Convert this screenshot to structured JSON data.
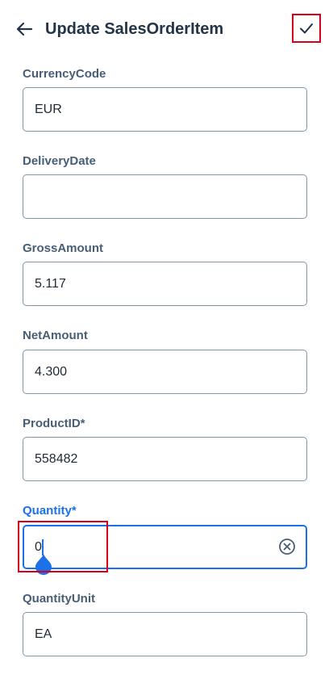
{
  "header": {
    "title": "Update SalesOrderItem",
    "back_icon": "arrow-left-icon",
    "save_icon": "checkmark-icon"
  },
  "fields": [
    {
      "label": "CurrencyCode",
      "value": "EUR"
    },
    {
      "label": "DeliveryDate",
      "value": ""
    },
    {
      "label": "GrossAmount",
      "value": "5.117"
    },
    {
      "label": "NetAmount",
      "value": "4.300"
    },
    {
      "label": "ProductID*",
      "value": "558482"
    },
    {
      "label": "Quantity*",
      "value": "0",
      "focused": true,
      "clear_icon": "clear-circle-icon"
    },
    {
      "label": "QuantityUnit",
      "value": "EA"
    }
  ],
  "colors": {
    "accent": "#1b72e8",
    "label": "#475e75",
    "title": "#223548",
    "border": "#8396a8",
    "highlight": "#d6001c"
  }
}
